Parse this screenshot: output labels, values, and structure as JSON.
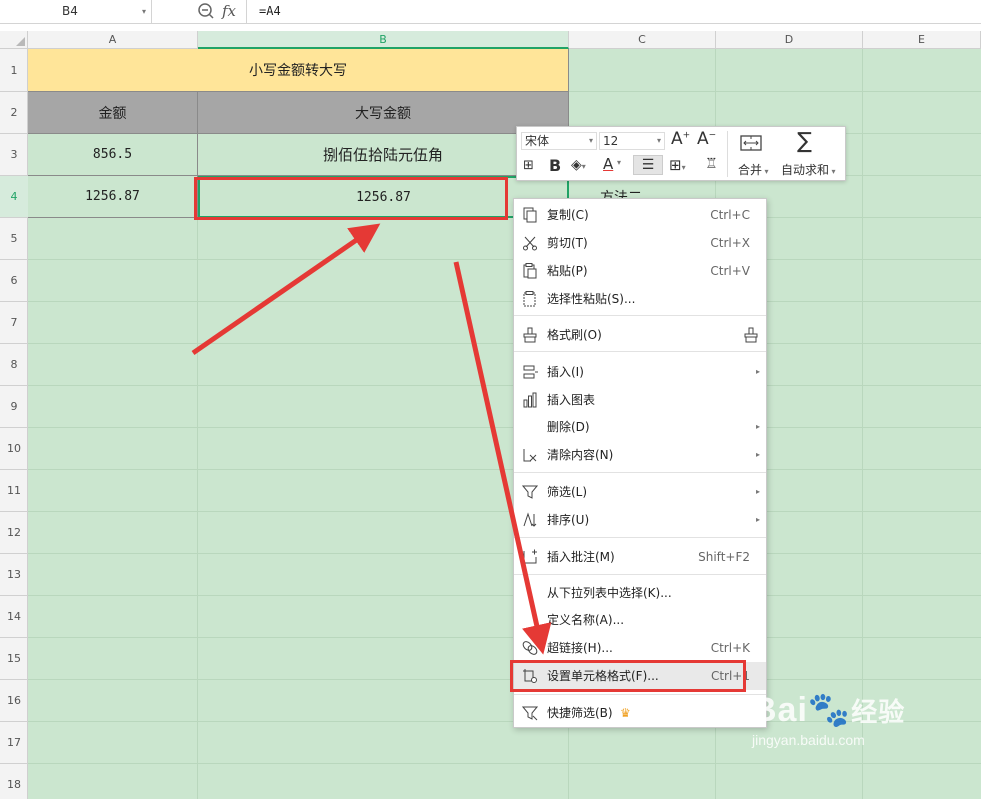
{
  "formula_bar": {
    "name_box": "B4",
    "fx_label": "fx",
    "formula": "=A4"
  },
  "columns": [
    "A",
    "B",
    "C",
    "D",
    "E"
  ],
  "rows": [
    "1",
    "2",
    "3",
    "4",
    "5",
    "6",
    "7",
    "8",
    "9",
    "10",
    "11",
    "12",
    "13",
    "14",
    "15",
    "16",
    "17",
    "18"
  ],
  "sheet": {
    "title": "小写金额转大写",
    "header_amount": "金额",
    "header_upper": "大写金额",
    "r3_amount": "856.5",
    "r3_upper": "捌佰伍拾陆元伍角",
    "r4_amount": "1256.87",
    "r4_upper": "1256.87",
    "c4_partial": "方法二"
  },
  "mini_toolbar": {
    "font_name": "宋体",
    "font_size": "12",
    "bold": "B",
    "font_color": "A",
    "merge_label": "合并",
    "autosum_label": "自动求和"
  },
  "context_menu": {
    "copy": {
      "label": "复制(C)",
      "shortcut": "Ctrl+C"
    },
    "cut": {
      "label": "剪切(T)",
      "shortcut": "Ctrl+X"
    },
    "paste": {
      "label": "粘贴(P)",
      "shortcut": "Ctrl+V"
    },
    "paste_special": {
      "label": "选择性粘贴(S)..."
    },
    "format_painter": {
      "label": "格式刷(O)"
    },
    "insert": {
      "label": "插入(I)"
    },
    "insert_chart": {
      "label": "插入图表"
    },
    "delete": {
      "label": "删除(D)"
    },
    "clear": {
      "label": "清除内容(N)"
    },
    "filter": {
      "label": "筛选(L)"
    },
    "sort": {
      "label": "排序(U)"
    },
    "insert_comment": {
      "label": "插入批注(M)",
      "shortcut": "Shift+F2"
    },
    "pick_list": {
      "label": "从下拉列表中选择(K)..."
    },
    "define_name": {
      "label": "定义名称(A)..."
    },
    "hyperlink": {
      "label": "超链接(H)...",
      "shortcut": "Ctrl+K"
    },
    "format_cells": {
      "label": "设置单元格格式(F)...",
      "shortcut": "Ctrl+1"
    },
    "quick_filter": {
      "label": "快捷筛选(B)"
    }
  },
  "watermark": {
    "brand": "Bai",
    "brand_cn": "经验",
    "url": "jingyan.baidu.com"
  },
  "colors": {
    "grid_bg": "#cbe6cf",
    "title_bg": "#ffe599",
    "header_bg": "#a6a6a6",
    "select": "#21a366",
    "annotation": "#e53935"
  }
}
